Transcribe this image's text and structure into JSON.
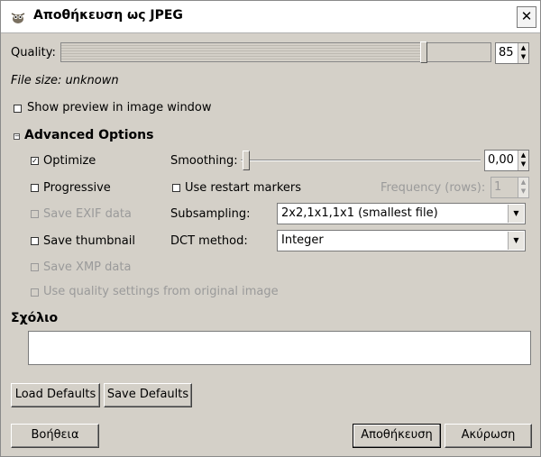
{
  "window": {
    "title": "Αποθήκευση ως JPEG",
    "close_icon": "close-icon"
  },
  "quality": {
    "label": "Quality:",
    "value": "85",
    "level_fraction": 0.85
  },
  "file_size": {
    "text": "File size: unknown"
  },
  "show_preview": {
    "label": "Show preview in image window",
    "checked": false
  },
  "advanced": {
    "header": "Advanced Options",
    "expanded": true
  },
  "optimize": {
    "label": "Optimize",
    "checked": true
  },
  "progressive": {
    "label": "Progressive",
    "checked": false
  },
  "save_exif": {
    "label": "Save EXIF data",
    "checked": false,
    "enabled": false
  },
  "save_thumbnail": {
    "label": "Save thumbnail",
    "checked": false
  },
  "save_xmp": {
    "label": "Save XMP data",
    "checked": false,
    "enabled": false
  },
  "use_quality": {
    "label": "Use quality settings from original image",
    "checked": false,
    "enabled": false
  },
  "smoothing": {
    "label": "Smoothing:",
    "value": "0,00"
  },
  "restart_markers": {
    "label": "Use restart markers",
    "checked": false
  },
  "frequency": {
    "label": "Frequency (rows):",
    "value": "1"
  },
  "subsampling": {
    "label": "Subsampling:",
    "value": "2x2,1x1,1x1 (smallest file)"
  },
  "dct_method": {
    "label": "DCT method:",
    "value": "Integer"
  },
  "comment": {
    "label": "Σχόλιο",
    "value": ""
  },
  "buttons": {
    "load_defaults": "Load Defaults",
    "save_defaults": "Save Defaults",
    "help": "Βοήθεια",
    "save": "Αποθήκευση",
    "cancel": "Ακύρωση"
  },
  "colors": {
    "dialog_bg": "#d4d0c8",
    "disabled_text": "#9a9a9a"
  }
}
